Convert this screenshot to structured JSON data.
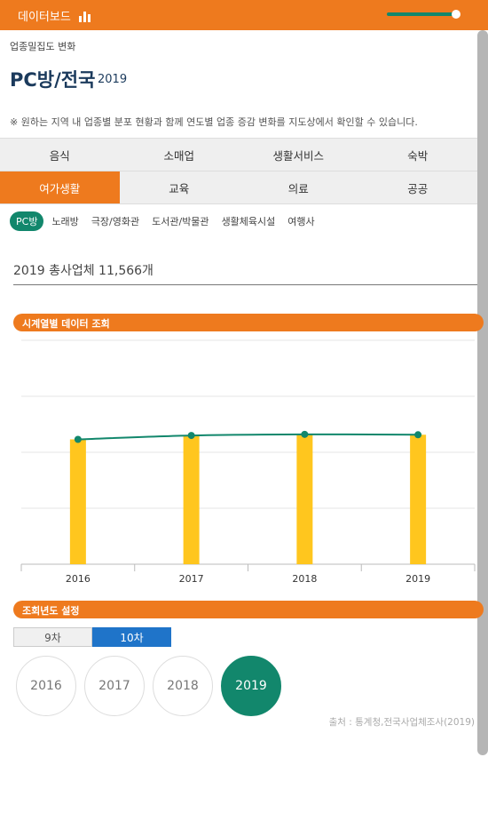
{
  "header": {
    "title": "데이터보드",
    "chart_icon": "bar-chart-icon"
  },
  "breadcrumb": "업종밀집도 변화",
  "page": {
    "title": "PC방/전국",
    "year": "2019"
  },
  "notice": "※ 원하는 지역 내 업종별 분포 현황과 함께 연도별 업종 증감 변화를 지도상에서 확인할 수 있습니다.",
  "tabs_row1": [
    "음식",
    "소매업",
    "생활서비스",
    "숙박"
  ],
  "tabs_row2": [
    "여가생활",
    "교육",
    "의료",
    "공공"
  ],
  "active_tab": "여가생활",
  "sub_categories": [
    "PC방",
    "노래방",
    "극장/영화관",
    "도서관/박물관",
    "생활체육시설",
    "여행사"
  ],
  "active_sub": "PC방",
  "total": "2019 총사업체 11,566개",
  "section_timeseries": "시계열별 데이터 조회",
  "section_year_setting": "조회년도 설정",
  "generation": [
    "9차",
    "10차"
  ],
  "active_generation": "10차",
  "years": [
    "2016",
    "2017",
    "2018",
    "2019"
  ],
  "active_year": "2019",
  "source": "출처 : 통계청,전국사업체조사(2019)",
  "colors": {
    "accent": "#ee7a1e",
    "green": "#12876c",
    "bar": "#ffc61e",
    "blue": "#1f74c9"
  },
  "chart_data": {
    "type": "bar",
    "categories": [
      "2016",
      "2017",
      "2018",
      "2019"
    ],
    "values": [
      11150,
      11500,
      11600,
      11566
    ],
    "line_values": [
      11150,
      11500,
      11600,
      11566
    ],
    "ylim": [
      0,
      20000
    ],
    "grid": true,
    "show_y_labels": false,
    "title": "",
    "xlabel": "",
    "ylabel": ""
  }
}
